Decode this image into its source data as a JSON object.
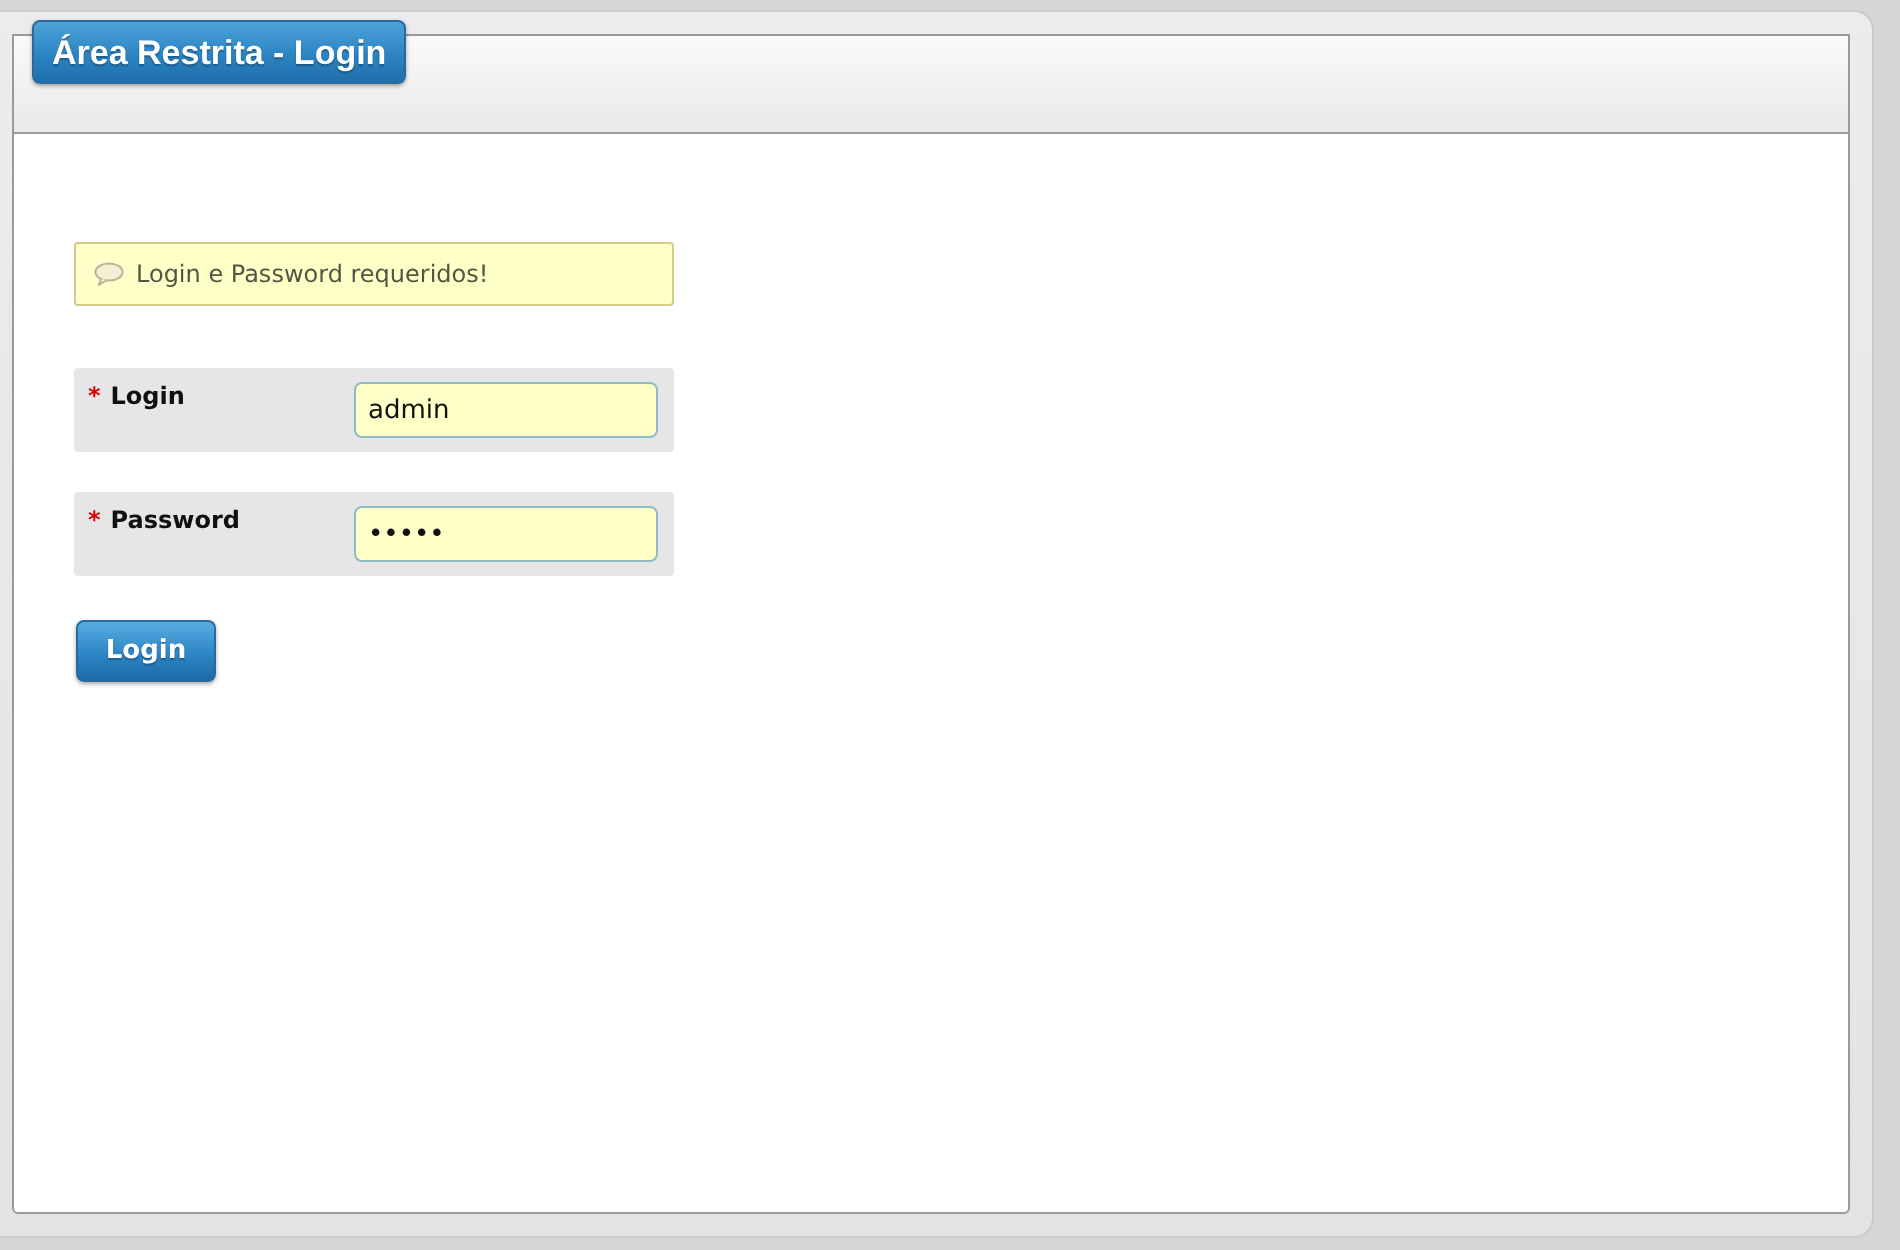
{
  "page_title": "Área Restrita - Login",
  "message": {
    "text": "Login e Password requeridos!"
  },
  "fields": [
    {
      "required_mark": "*",
      "label": "Login",
      "value": "admin"
    },
    {
      "required_mark": "*",
      "label": "Password",
      "value": "•••••"
    }
  ],
  "submit_button": {
    "label": "Login"
  }
}
